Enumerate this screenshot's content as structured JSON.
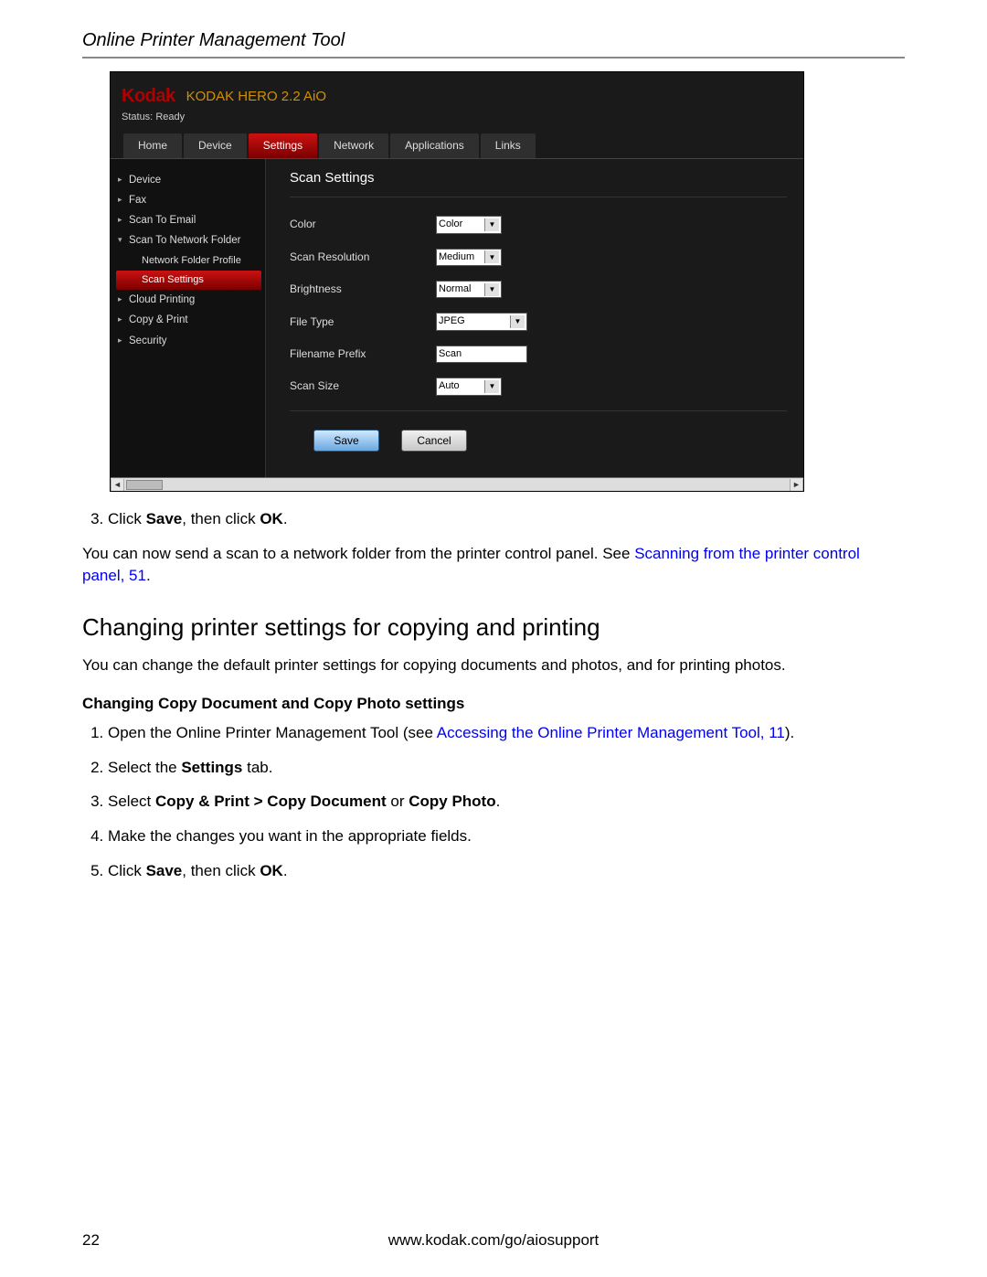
{
  "doc_header": "Online Printer Management Tool",
  "screenshot": {
    "brand": "Kodak",
    "model": "KODAK HERO 2.2 AiO",
    "status_label": "Status:",
    "status_value": "Ready",
    "tabs": [
      "Home",
      "Device",
      "Settings",
      "Network",
      "Applications",
      "Links"
    ],
    "sidebar": {
      "items": [
        {
          "label": "Device"
        },
        {
          "label": "Fax"
        },
        {
          "label": "Scan To Email"
        },
        {
          "label": "Scan To Network Folder",
          "expanded": true
        },
        {
          "label": "Cloud Printing"
        },
        {
          "label": "Copy & Print"
        },
        {
          "label": "Security"
        }
      ],
      "subs": [
        {
          "label": "Network Folder Profile"
        },
        {
          "label": "Scan Settings",
          "active": true
        }
      ]
    },
    "pane": {
      "title": "Scan Settings",
      "fields": {
        "color": {
          "label": "Color",
          "value": "Color"
        },
        "resolution": {
          "label": "Scan Resolution",
          "value": "Medium"
        },
        "brightness": {
          "label": "Brightness",
          "value": "Normal"
        },
        "filetype": {
          "label": "File Type",
          "value": "JPEG"
        },
        "prefix": {
          "label": "Filename Prefix",
          "value": "Scan"
        },
        "scansize": {
          "label": "Scan Size",
          "value": "Auto"
        }
      },
      "save": "Save",
      "cancel": "Cancel"
    }
  },
  "step3_a": "Click ",
  "step3_b": "Save",
  "step3_c": ", then click ",
  "step3_d": "OK",
  "step3_e": ".",
  "para_after": "You can now send a scan to a network folder from the printer control panel. See  ",
  "link_scan": "Scanning from the printer control panel, 51",
  "period": ".",
  "h2": "Changing printer settings for copying and printing",
  "para_intro": "You can change the default printer settings for copying documents and photos, and for printing photos.",
  "h3": "Changing Copy Document and Copy Photo settings",
  "steps": {
    "s1_a": "Open the Online Printer Management Tool (see  ",
    "s1_link": "Accessing the Online Printer Management Tool, 11",
    "s1_b": ").",
    "s2_a": "Select the ",
    "s2_b": "Settings",
    "s2_c": " tab.",
    "s3_a": "Select ",
    "s3_b": "Copy & Print > Copy Document",
    "s3_c": " or ",
    "s3_d": "Copy Photo",
    "s3_e": ".",
    "s4": "Make the changes you want in the appropriate fields.",
    "s5_a": "Click ",
    "s5_b": "Save",
    "s5_c": ", then click ",
    "s5_d": "OK",
    "s5_e": "."
  },
  "page_number": "22",
  "footer_url": "www.kodak.com/go/aiosupport"
}
